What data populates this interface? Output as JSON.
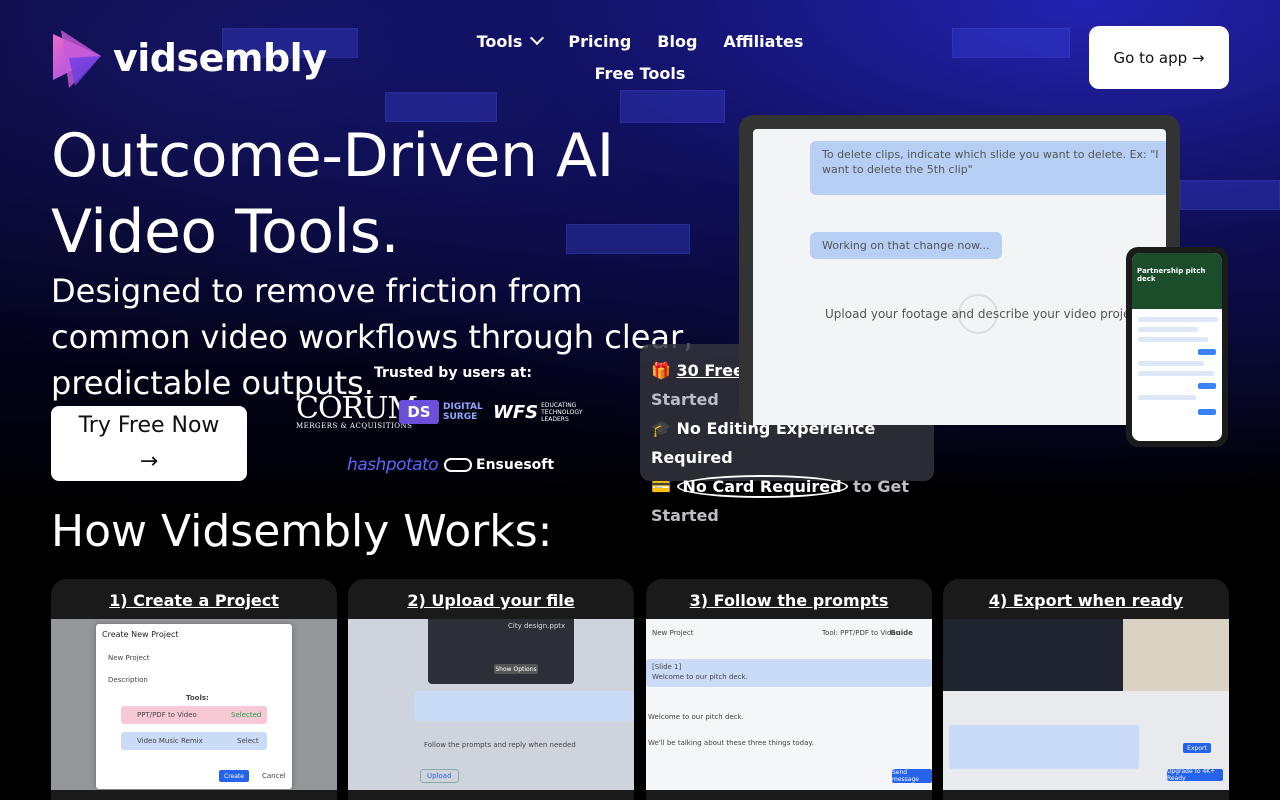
{
  "colors": {
    "brand": "#6b4fd8",
    "accent_blue": "#2563eb",
    "hashpotato": "#5a66ff"
  },
  "brand": {
    "name": "vidsembly",
    "logo_icon": "vidsembly-logo-icon"
  },
  "nav": {
    "tools": "Tools",
    "pricing": "Pricing",
    "blog": "Blog",
    "affiliates": "Affiliates",
    "free_tools": "Free Tools",
    "tools_icon": "chevron-down-icon"
  },
  "header": {
    "cta": "Go to app →"
  },
  "hero": {
    "title": "Outcome-Driven AI Video Tools.",
    "subtitle": "Designed to remove friction from common video workflows through clear, predictable outputs.",
    "cta_line1": "Try Free Now",
    "cta_line2": "→"
  },
  "trusted": {
    "label": "Trusted by users at:",
    "corum": "CORUM",
    "corum_sub": "MERGERS & ACQUISITIONS",
    "ds": "DS",
    "ds_text1": "DIGITAL",
    "ds_text2": "SURGE",
    "wfs": "WFS",
    "wfs_sub": "EDUCATING TECHNOLOGY LEADERS",
    "hashpotato": "hashpotato",
    "ensuesoft": "Ensuesoft"
  },
  "features": {
    "item1_emoji": "🎁",
    "item1_link": "30 Free Credits",
    "item1_rest": " to Get Started",
    "item2_emoji": "🎓",
    "item2_text": "No Editing Experience Required",
    "item3_emoji": "💳",
    "item3_link": "No Card Required",
    "item3_rest": " to Get Started"
  },
  "laptop": {
    "bubble1": "To delete clips, indicate which slide you want to delete. Ex: \"I want to delete the 5th clip\"",
    "bubble2": "Working on that change now...",
    "note": "Upload your footage and describe your video project"
  },
  "phone": {
    "title": "Partnership pitch deck"
  },
  "works": {
    "title": "How Vidsembly Works:",
    "steps": [
      {
        "label": "1) Create a Project"
      },
      {
        "label": "2) Upload your file"
      },
      {
        "label": "3) Follow the prompts"
      },
      {
        "label": "4) Export when ready"
      }
    ]
  },
  "shots": {
    "s1_title": "Create New Project",
    "s1_name": "New Project",
    "s1_desc": "Description",
    "s1_tools": "Tools:",
    "s1_tool1": "PPT/PDF to Video",
    "s1_tool1_state": "Selected",
    "s1_tool2": "Video Music Remix",
    "s1_tool2_state": "Select",
    "s1_create": "Create",
    "s1_cancel": "Cancel",
    "s2_file1": "City design.pptx",
    "s2_show": "Show Options",
    "s2_prompt": "Follow the prompts and reply when needed",
    "s2_upload": "Upload",
    "s3_header": "New Project",
    "s3_tool": "Tool: PPT/PDF to Video",
    "s3_guide": "Guide",
    "s3_slide1": "[Slide 1]",
    "s3_slide1_text": "Welcome to our pitch deck.",
    "s3_slide2_text": "We'll be talking about these three things today.",
    "s3_send": "Send message",
    "s4_export": "Export",
    "s4_upgrade": "Upgrade to 4K+ Ready"
  }
}
